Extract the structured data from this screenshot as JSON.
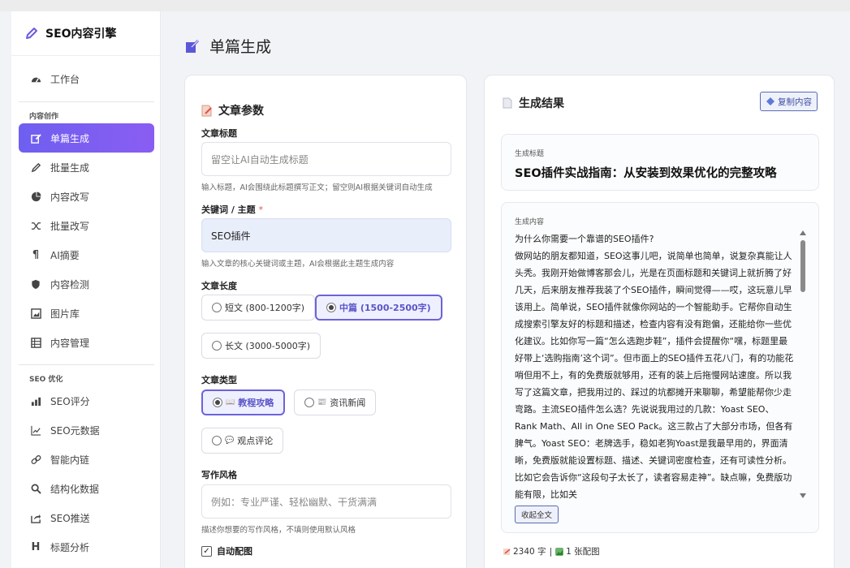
{
  "app": {
    "brand": "SEO内容引擎",
    "page_title": "单篇生成"
  },
  "sidebar": {
    "dashboard": "工作台",
    "section_content": "内容创作",
    "section_seo": "SEO 优化",
    "items": [
      {
        "label": "单篇生成",
        "icon": "edit-icon",
        "active": true
      },
      {
        "label": "批量生成",
        "icon": "pencil-icon"
      },
      {
        "label": "内容改写",
        "icon": "pie-icon"
      },
      {
        "label": "批量改写",
        "icon": "shuffle-icon"
      },
      {
        "label": "AI摘要",
        "icon": "paragraph-icon"
      },
      {
        "label": "内容检测",
        "icon": "shield-icon"
      },
      {
        "label": "图片库",
        "icon": "image-icon"
      },
      {
        "label": "内容管理",
        "icon": "list-icon"
      }
    ],
    "seo_items": [
      {
        "label": "SEO评分",
        "icon": "bar-chart-icon"
      },
      {
        "label": "SEO元数据",
        "icon": "line-chart-icon"
      },
      {
        "label": "智能内链",
        "icon": "link-icon"
      },
      {
        "label": "结构化数据",
        "icon": "search-icon"
      },
      {
        "label": "SEO推送",
        "icon": "share-icon"
      },
      {
        "label": "标题分析",
        "icon": "heading-icon"
      }
    ]
  },
  "form": {
    "title": "文章参数",
    "article_title_label": "文章标题",
    "article_title_placeholder": "留空让AI自动生成标题",
    "article_title_hint": "输入标题，AI会围绕此标题撰写正文；留空则AI根据关键词自动生成",
    "keyword_label": "关键词 / 主题",
    "keyword_required": "*",
    "keyword_value": "SEO插件",
    "keyword_hint": "输入文章的核心关键词或主题，AI会根据此主题生成内容",
    "length_label": "文章长度",
    "length_options": [
      "短文 (800-1200字)",
      "中篇 (1500-2500字)",
      "长文 (3000-5000字)"
    ],
    "length_selected": "中篇 (1500-2500字)",
    "type_label": "文章类型",
    "type_options": [
      "教程攻略",
      "资讯新闻",
      "观点评论"
    ],
    "type_selected": "教程攻略",
    "style_label": "写作风格",
    "style_placeholder": "例如：专业严谨、轻松幽默、干货满满",
    "style_hint": "描述你想要的写作风格，不填则使用默认风格",
    "auto_image_label": "自动配图",
    "auto_image_checked": true
  },
  "result": {
    "title": "生成结果",
    "copy_button": "复制内容",
    "gen_title_label": "生成标题",
    "gen_title": "SEO插件实战指南：从安装到效果优化的完整攻略",
    "content_label": "生成内容",
    "content_lines": [
      "为什么你需要一个靠谱的SEO插件?",
      "做网站的朋友都知道，SEO这事儿吧，说简单也简单，说复杂真能让人头秃。我刚开始做博客那会儿，光是在页面标题和关键词上就折腾了好几天，后来朋友推荐我装了个SEO插件，瞬间觉得——哎，这玩意儿早该用上。简单说，SEO插件就像你网站的一个智能助手。它帮你自动生成搜索引擎友好的标题和描述，检查内容有没有跑偏，还能给你一些优化建议。比如你写一篇“怎么选跑步鞋”，插件会提醒你“嘿，标题里最好带上‘选购指南’这个词”。但市面上的SEO插件五花八门，有的功能花哨但用不上，有的免费版就够用，还有的装上后拖慢网站速度。所以我写了这篇文章，把我用过的、踩过的坑都摊开来聊聊，希望能帮你少走弯路。主流SEO插件怎么选？先说说我用过的几款：Yoast SEO、Rank Math、All in One SEO Pack。这三款占了大部分市场，但各有脾气。Yoast SEO：老牌选手，稳如老狗Yoast是我最早用的，界面清晰，免费版就能设置标题、描述、关键词密度检查，还有可读性分析。比如它会告诉你“这段句子太长了，读者容易走神”。缺点嘛，免费版功能有限，比如关"
    ],
    "collapse_button": "收起全文",
    "word_count": "2340 字",
    "separator": "|",
    "image_count": "1 张配图"
  },
  "colors": {
    "accent": "#7060f0",
    "accent_dark": "#5b54c8",
    "required": "#e0524f"
  }
}
